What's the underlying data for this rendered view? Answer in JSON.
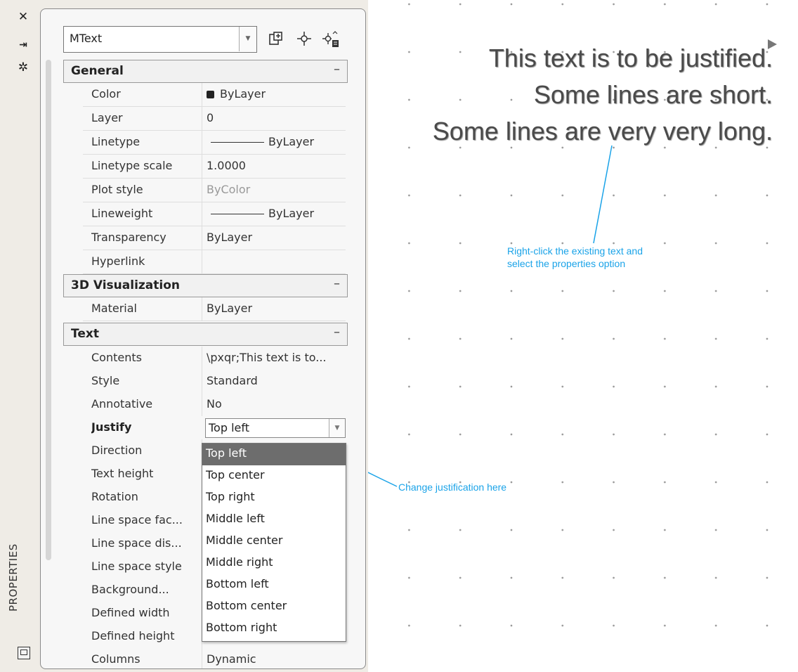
{
  "palette": {
    "strip_buttons": [
      "✕",
      "⇥",
      "✲"
    ],
    "vertical_title": "PROPERTIES",
    "object_type": "MText",
    "toolbar_icons": [
      "toggle-pickadd-icon",
      "select-objects-icon",
      "quick-select-icon"
    ]
  },
  "sections": [
    {
      "title": "General",
      "collapse": "–",
      "rows": [
        {
          "name": "Color",
          "value": "ByLayer",
          "kind": "swatch"
        },
        {
          "name": "Layer",
          "value": "0"
        },
        {
          "name": "Linetype",
          "value": "ByLayer",
          "kind": "line"
        },
        {
          "name": "Linetype scale",
          "value": "1.0000"
        },
        {
          "name": "Plot style",
          "value": "ByColor",
          "kind": "gray"
        },
        {
          "name": "Lineweight",
          "value": "ByLayer",
          "kind": "line"
        },
        {
          "name": "Transparency",
          "value": "ByLayer"
        },
        {
          "name": "Hyperlink",
          "value": ""
        }
      ]
    },
    {
      "title": "3D Visualization",
      "collapse": "–",
      "rows": [
        {
          "name": "Material",
          "value": "ByLayer"
        }
      ]
    },
    {
      "title": "Text",
      "collapse": "–",
      "rows": [
        {
          "name": "Contents",
          "value": "\\pxqr;This text is to..."
        },
        {
          "name": "Style",
          "value": "Standard"
        },
        {
          "name": "Annotative",
          "value": "No"
        },
        {
          "name": "Justify",
          "value": "Top left",
          "kind": "combo"
        },
        {
          "name": "Direction",
          "value": ""
        },
        {
          "name": "Text height",
          "value": ""
        },
        {
          "name": "Rotation",
          "value": ""
        },
        {
          "name": "Line space fac...",
          "value": ""
        },
        {
          "name": "Line space dis...",
          "value": ""
        },
        {
          "name": "Line space style",
          "value": ""
        },
        {
          "name": "Background...",
          "value": ""
        },
        {
          "name": "Defined width",
          "value": ""
        },
        {
          "name": "Defined height",
          "value": ""
        },
        {
          "name": "Columns",
          "value": "Dynamic"
        }
      ]
    }
  ],
  "justify_options": [
    "Top left",
    "Top center",
    "Top right",
    "Middle left",
    "Middle center",
    "Middle right",
    "Bottom left",
    "Bottom center",
    "Bottom right"
  ],
  "justify_selected": "Top left",
  "drawing": {
    "mtext_lines": [
      "This text is to be justified.",
      "Some lines are short.",
      "Some lines are very very long."
    ],
    "callout_properties": [
      "Right-click the existing text and",
      "select the properties option"
    ],
    "callout_justify": "Change justification here",
    "callout_color": "#1aa3e8"
  }
}
